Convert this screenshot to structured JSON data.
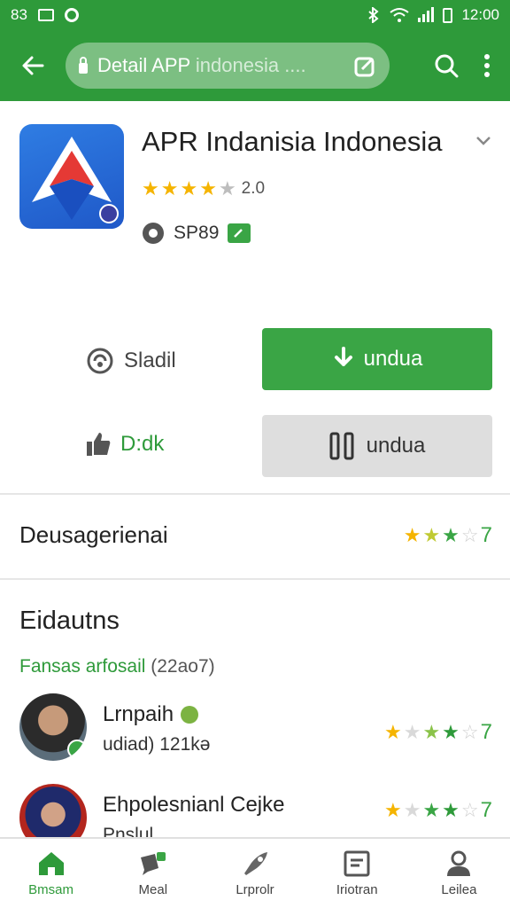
{
  "status_bar": {
    "left_text": "83",
    "time": "12:00"
  },
  "search": {
    "query_main": "Detail APP ",
    "query_dim": "indonesia ...."
  },
  "app": {
    "title": "APR Indanisia Indonesia",
    "rating_value": "2.0",
    "meta_label": "SP89"
  },
  "actions": {
    "share_label": "Sladil",
    "install_label": "undua",
    "like_label": "D:dk",
    "secondary_label": "undua"
  },
  "rating_row": {
    "label": "Deusagerienai",
    "value": "7"
  },
  "reviews_section": {
    "title": "Eidautns",
    "filter_label": "Fansas arfosail ",
    "filter_count": "(22ao7)",
    "items": [
      {
        "name": "Lrnpaih",
        "meta": "udiad) 121kə",
        "score": "7"
      },
      {
        "name": "Ehpolesnianl Cejke",
        "meta": "Pnslul",
        "score": "7"
      }
    ]
  },
  "bottom_nav": [
    {
      "label": "Bmsam",
      "icon": "home-icon",
      "active": true
    },
    {
      "label": "Meal",
      "icon": "chat-icon",
      "active": false
    },
    {
      "label": "Lrprolr",
      "icon": "rocket-icon",
      "active": false
    },
    {
      "label": "Iriotran",
      "icon": "document-icon",
      "active": false
    },
    {
      "label": "Leilea",
      "icon": "person-icon",
      "active": false
    }
  ],
  "colors": {
    "primary": "#2e9a3a",
    "accent": "#3aa545",
    "star": "#f5b400"
  }
}
